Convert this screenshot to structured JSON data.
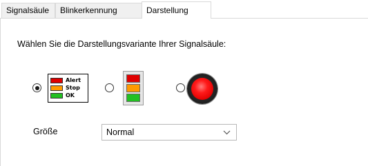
{
  "tabs": [
    {
      "label": "Signalsäule"
    },
    {
      "label": "Blinkerkennung"
    },
    {
      "label": "Darstellung"
    }
  ],
  "prompt": "Wählen Sie die Darstellungsvariante Ihrer Signalsäule:",
  "variants": {
    "selected_index": 0,
    "legend": {
      "rows": [
        {
          "label": "Alert",
          "color": "#e00000"
        },
        {
          "label": "Stop",
          "color": "#ff9a00"
        },
        {
          "label": "OK",
          "color": "#22c022"
        }
      ]
    },
    "column_colors": [
      "#e00000",
      "#ff9a00",
      "#22c022"
    ],
    "lamp_color": "#ff1a1a"
  },
  "size": {
    "label": "Größe",
    "value": "Normal"
  }
}
